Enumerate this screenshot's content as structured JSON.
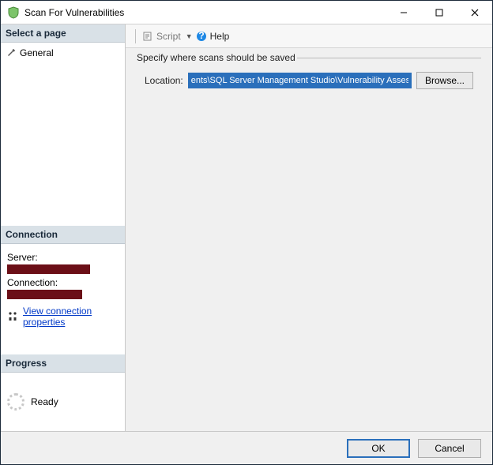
{
  "window": {
    "title": "Scan For Vulnerabilities"
  },
  "sidebar": {
    "select_page_header": "Select a page",
    "pages": [
      {
        "label": "General"
      }
    ],
    "connection_header": "Connection",
    "server_label": "Server:",
    "connection_label": "Connection:",
    "view_props_link": "View connection properties",
    "progress_header": "Progress",
    "progress_status": "Ready"
  },
  "toolbar": {
    "script_label": "Script",
    "help_label": "Help"
  },
  "content": {
    "group_title": "Specify where scans should be saved",
    "location_label": "Location:",
    "location_value": "ents\\SQL Server Management Studio\\Vulnerability Assessment Reports",
    "browse_label": "Browse..."
  },
  "footer": {
    "ok_label": "OK",
    "cancel_label": "Cancel"
  }
}
